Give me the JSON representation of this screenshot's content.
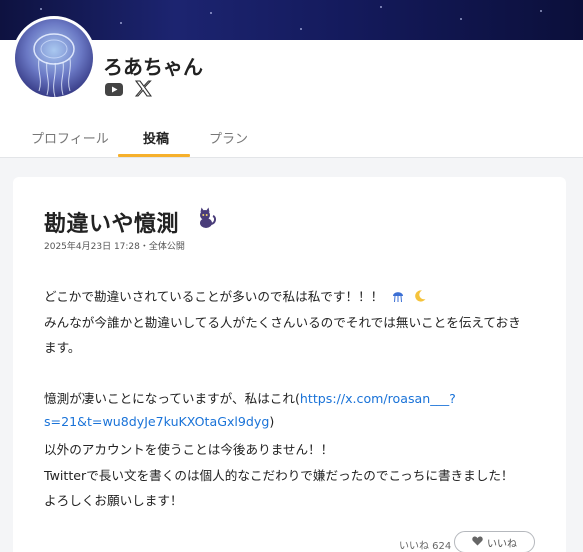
{
  "creator": {
    "name": "ろあちゃん",
    "avatar": "jellyfish-avatar",
    "social": [
      "youtube-icon",
      "x-icon"
    ]
  },
  "tabs": [
    {
      "label": "プロフィール",
      "active": false
    },
    {
      "label": "投稿",
      "active": true
    },
    {
      "label": "プラン",
      "active": false
    }
  ],
  "post": {
    "title": "勘違いや憶測",
    "title_emoji": "black-cat-icon",
    "meta": "2025年4月23日 17:28・全体公開",
    "lines": [
      "どこかで勘違いされていることが多いので私は私です！！！",
      "みんなが今誰かと勘違いしてる人がたくさんいるのでそれでは無いことを伝えておき",
      "ます。",
      "憶測が凄いことになっていますが、私はこれ(",
      "https://x.com/roasan___?",
      "s=21&t=wu8dyJe7kuKXOtaGxl9dyg",
      ")",
      "以外のアカウントを使うことは今後ありません！！",
      "Twitterで長い文を書くのは個人的なこだわりで嫌だったのでこっちに書きました！",
      "よろしくお願いします！"
    ],
    "likes_label": "いいね 624",
    "like_button": "いいね"
  },
  "colors": {
    "accent_tab": "#f6b02c",
    "link": "#1a73d8"
  }
}
